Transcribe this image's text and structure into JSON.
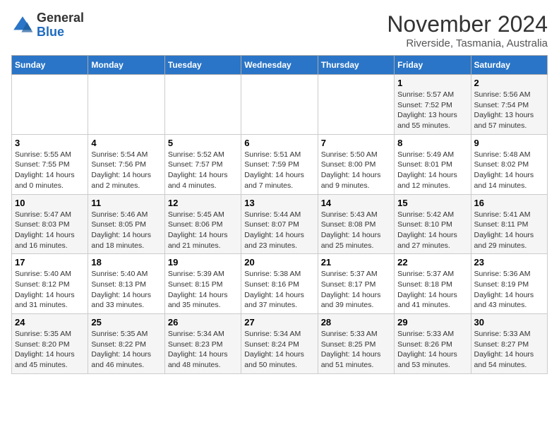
{
  "logo": {
    "general": "General",
    "blue": "Blue"
  },
  "header": {
    "month": "November 2024",
    "location": "Riverside, Tasmania, Australia"
  },
  "weekdays": [
    "Sunday",
    "Monday",
    "Tuesday",
    "Wednesday",
    "Thursday",
    "Friday",
    "Saturday"
  ],
  "weeks": [
    [
      {
        "day": "",
        "details": ""
      },
      {
        "day": "",
        "details": ""
      },
      {
        "day": "",
        "details": ""
      },
      {
        "day": "",
        "details": ""
      },
      {
        "day": "",
        "details": ""
      },
      {
        "day": "1",
        "details": "Sunrise: 5:57 AM\nSunset: 7:52 PM\nDaylight: 13 hours and 55 minutes."
      },
      {
        "day": "2",
        "details": "Sunrise: 5:56 AM\nSunset: 7:54 PM\nDaylight: 13 hours and 57 minutes."
      }
    ],
    [
      {
        "day": "3",
        "details": "Sunrise: 5:55 AM\nSunset: 7:55 PM\nDaylight: 14 hours and 0 minutes."
      },
      {
        "day": "4",
        "details": "Sunrise: 5:54 AM\nSunset: 7:56 PM\nDaylight: 14 hours and 2 minutes."
      },
      {
        "day": "5",
        "details": "Sunrise: 5:52 AM\nSunset: 7:57 PM\nDaylight: 14 hours and 4 minutes."
      },
      {
        "day": "6",
        "details": "Sunrise: 5:51 AM\nSunset: 7:59 PM\nDaylight: 14 hours and 7 minutes."
      },
      {
        "day": "7",
        "details": "Sunrise: 5:50 AM\nSunset: 8:00 PM\nDaylight: 14 hours and 9 minutes."
      },
      {
        "day": "8",
        "details": "Sunrise: 5:49 AM\nSunset: 8:01 PM\nDaylight: 14 hours and 12 minutes."
      },
      {
        "day": "9",
        "details": "Sunrise: 5:48 AM\nSunset: 8:02 PM\nDaylight: 14 hours and 14 minutes."
      }
    ],
    [
      {
        "day": "10",
        "details": "Sunrise: 5:47 AM\nSunset: 8:03 PM\nDaylight: 14 hours and 16 minutes."
      },
      {
        "day": "11",
        "details": "Sunrise: 5:46 AM\nSunset: 8:05 PM\nDaylight: 14 hours and 18 minutes."
      },
      {
        "day": "12",
        "details": "Sunrise: 5:45 AM\nSunset: 8:06 PM\nDaylight: 14 hours and 21 minutes."
      },
      {
        "day": "13",
        "details": "Sunrise: 5:44 AM\nSunset: 8:07 PM\nDaylight: 14 hours and 23 minutes."
      },
      {
        "day": "14",
        "details": "Sunrise: 5:43 AM\nSunset: 8:08 PM\nDaylight: 14 hours and 25 minutes."
      },
      {
        "day": "15",
        "details": "Sunrise: 5:42 AM\nSunset: 8:10 PM\nDaylight: 14 hours and 27 minutes."
      },
      {
        "day": "16",
        "details": "Sunrise: 5:41 AM\nSunset: 8:11 PM\nDaylight: 14 hours and 29 minutes."
      }
    ],
    [
      {
        "day": "17",
        "details": "Sunrise: 5:40 AM\nSunset: 8:12 PM\nDaylight: 14 hours and 31 minutes."
      },
      {
        "day": "18",
        "details": "Sunrise: 5:40 AM\nSunset: 8:13 PM\nDaylight: 14 hours and 33 minutes."
      },
      {
        "day": "19",
        "details": "Sunrise: 5:39 AM\nSunset: 8:15 PM\nDaylight: 14 hours and 35 minutes."
      },
      {
        "day": "20",
        "details": "Sunrise: 5:38 AM\nSunset: 8:16 PM\nDaylight: 14 hours and 37 minutes."
      },
      {
        "day": "21",
        "details": "Sunrise: 5:37 AM\nSunset: 8:17 PM\nDaylight: 14 hours and 39 minutes."
      },
      {
        "day": "22",
        "details": "Sunrise: 5:37 AM\nSunset: 8:18 PM\nDaylight: 14 hours and 41 minutes."
      },
      {
        "day": "23",
        "details": "Sunrise: 5:36 AM\nSunset: 8:19 PM\nDaylight: 14 hours and 43 minutes."
      }
    ],
    [
      {
        "day": "24",
        "details": "Sunrise: 5:35 AM\nSunset: 8:20 PM\nDaylight: 14 hours and 45 minutes."
      },
      {
        "day": "25",
        "details": "Sunrise: 5:35 AM\nSunset: 8:22 PM\nDaylight: 14 hours and 46 minutes."
      },
      {
        "day": "26",
        "details": "Sunrise: 5:34 AM\nSunset: 8:23 PM\nDaylight: 14 hours and 48 minutes."
      },
      {
        "day": "27",
        "details": "Sunrise: 5:34 AM\nSunset: 8:24 PM\nDaylight: 14 hours and 50 minutes."
      },
      {
        "day": "28",
        "details": "Sunrise: 5:33 AM\nSunset: 8:25 PM\nDaylight: 14 hours and 51 minutes."
      },
      {
        "day": "29",
        "details": "Sunrise: 5:33 AM\nSunset: 8:26 PM\nDaylight: 14 hours and 53 minutes."
      },
      {
        "day": "30",
        "details": "Sunrise: 5:33 AM\nSunset: 8:27 PM\nDaylight: 14 hours and 54 minutes."
      }
    ]
  ]
}
